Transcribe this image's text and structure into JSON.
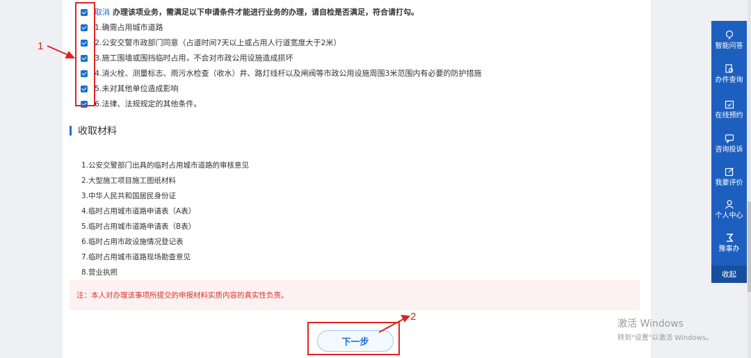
{
  "conditions": {
    "cancel_link": "取消",
    "notice": "办理该项业务，需满足以下申请条件才能进行业务的办理，请自检是否满足，符合请打勾。",
    "items": [
      {
        "label": "1.确需占用城市道路",
        "checked": true
      },
      {
        "label": "2.公安交警市政部门同意（占道时间7天以上或占用人行道宽度大于2米）",
        "checked": true
      },
      {
        "label": "3.施工围墙或围挡临时占用，不会对市政公用设施造成损坏",
        "checked": true
      },
      {
        "label": "4.消火栓、测量标志、雨污水检查（收水）井、路灯线杆以及闸阀等市政公用设施周围3米范围内有必要的防护措施",
        "checked": true
      },
      {
        "label": "5.未对其他单位造成影响",
        "checked": true
      },
      {
        "label": "6.法律、法规规定的其他条件。",
        "checked": true
      }
    ]
  },
  "materials": {
    "title": "收取材料",
    "items": [
      "1.公安交警部门出具的临时占用城市道路的审核意见",
      "2.大型施工项目施工图纸材料",
      "3.中华人民共和国居民身份证",
      "4.临时占用城市道路申请表（A表）",
      "5.临时占用城市道路申请表（B表）",
      "6.临时占用市政设施情况登记表",
      "7.临时占用城市道路现场勘查意见",
      "8.营业执照"
    ],
    "note": "注：本人对办理该事项所提交的申报材料实质内容的真实性负责。"
  },
  "next_button": "下一步",
  "annotations": {
    "label1": "1",
    "label2": "2"
  },
  "side_panel": {
    "items": [
      {
        "label": "智能问答",
        "icon": "chat-bulb-icon"
      },
      {
        "label": "办件查询",
        "icon": "doc-search-icon"
      },
      {
        "label": "在线预约",
        "icon": "calendar-icon"
      },
      {
        "label": "咨询投诉",
        "icon": "message-icon"
      },
      {
        "label": "我要评价",
        "icon": "edit-icon"
      },
      {
        "label": "个人中心",
        "icon": "user-icon"
      },
      {
        "label": "豫事办",
        "icon": "app-logo-icon"
      }
    ],
    "collapse": "收起"
  },
  "watermark": {
    "line1": "激活 Windows",
    "line2": "转到\"设置\"以激活 Windows。"
  },
  "colors": {
    "accent": "#1a6fd1",
    "panel": "#1d5fbf",
    "annotation": "#e0231f",
    "note_text": "#e03030"
  }
}
